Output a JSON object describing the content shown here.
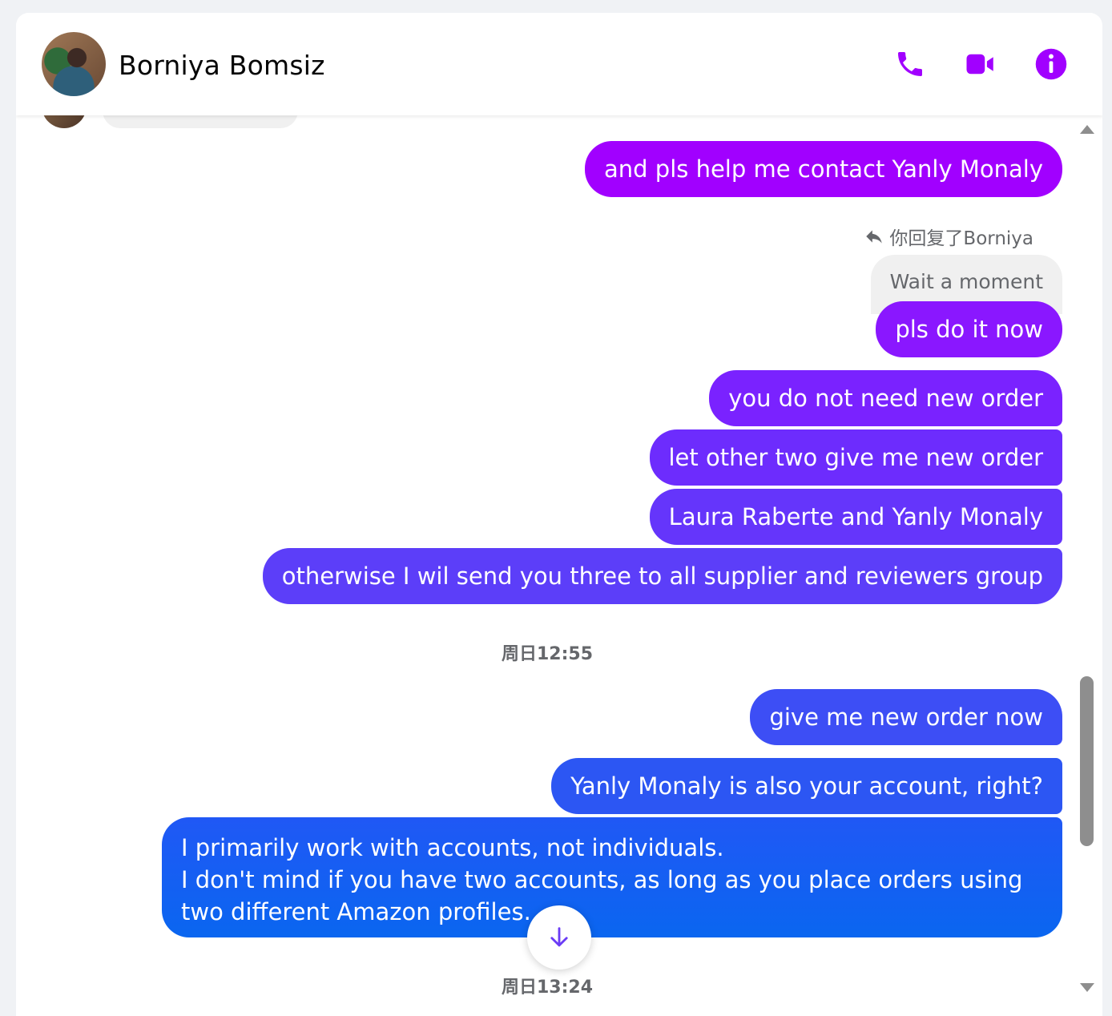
{
  "header": {
    "contact_name": "Borniya Bomsiz",
    "icons": [
      "phone-icon",
      "video-camera-icon",
      "info-icon"
    ]
  },
  "accent_color": "#a100ff",
  "messages": [
    {
      "text": "and pls help me contact Yanly Monaly",
      "sender": "me",
      "color": "#a100ff"
    },
    {
      "reply_label": "你回复了Borniya",
      "quoted_text": "Wait a moment"
    },
    {
      "text": "pls do it now",
      "sender": "me",
      "color": "#8a17ff"
    },
    {
      "text": "you do not need new order",
      "sender": "me",
      "color": "#7a22ff"
    },
    {
      "text": "let other two give me new order",
      "sender": "me",
      "color": "#6d2cfd"
    },
    {
      "text": "Laura Raberte and Yanly Monaly",
      "sender": "me",
      "color": "#6535fb"
    },
    {
      "text": "otherwise I wil send you three to all supplier and reviewers group",
      "sender": "me",
      "color": "#5c3ef9"
    },
    {
      "timestamp": "周日12:55"
    },
    {
      "text": "give me new order now",
      "sender": "me",
      "color": "#3d4ef5"
    },
    {
      "text": "Yanly Monaly is also your account, right?",
      "sender": "me",
      "color": "#2c56f3"
    },
    {
      "text": "I primarily work with accounts, not individuals.\nI don't mind if you have two accounts, as long as you place orders using two different Amazon profiles.",
      "sender": "me",
      "color": "#0a66f0"
    },
    {
      "timestamp": "周日13:24"
    }
  ]
}
